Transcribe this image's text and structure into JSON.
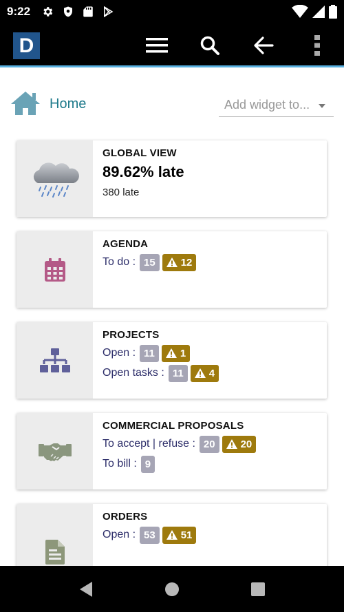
{
  "status_bar": {
    "time": "9:22",
    "left_icons": [
      "gear-icon",
      "shield-icon",
      "sd-card-icon",
      "play-store-icon"
    ],
    "right_icons": [
      "wifi-icon",
      "signal-icon",
      "battery-icon"
    ]
  },
  "app_bar": {
    "logo_letter": "D",
    "buttons": [
      "menu-icon",
      "search-icon",
      "back-arrow-icon",
      "more-vert-icon"
    ]
  },
  "breadcrumb": {
    "home_label": "Home",
    "add_widget_placeholder": "Add widget to..."
  },
  "cards": {
    "global_view": {
      "title": "GLOBAL VIEW",
      "value": "89.62% late",
      "sub": "380 late"
    },
    "agenda": {
      "title": "AGENDA",
      "todo_label": "To do :",
      "todo_count": "15",
      "todo_warn": "12"
    },
    "projects": {
      "title": "PROJECTS",
      "open_label": "Open :",
      "open_count": "11",
      "open_warn": "1",
      "tasks_label": "Open tasks :",
      "tasks_count": "11",
      "tasks_warn": "4"
    },
    "proposals": {
      "title": "COMMERCIAL PROPOSALS",
      "accept_label": "To accept | refuse :",
      "accept_count": "20",
      "accept_warn": "20",
      "bill_label": "To bill :",
      "bill_count": "9"
    },
    "orders": {
      "title": "ORDERS",
      "open_label": "Open :",
      "open_count": "53",
      "open_warn": "51"
    }
  },
  "colors": {
    "accent_line": "#58b0e0",
    "home_teal": "#207b8c",
    "label_navy": "#2d2e6a",
    "badge_grey": "#a6a5b5",
    "badge_warn": "#9e7a0d",
    "agenda_icon": "#b45a87",
    "projects_icon": "#5f609a",
    "proposals_icon": "#8a967e",
    "orders_icon": "#8d977a"
  },
  "nav_bar": {
    "buttons": [
      "nav-back-icon",
      "nav-home-icon",
      "nav-recents-icon"
    ]
  }
}
